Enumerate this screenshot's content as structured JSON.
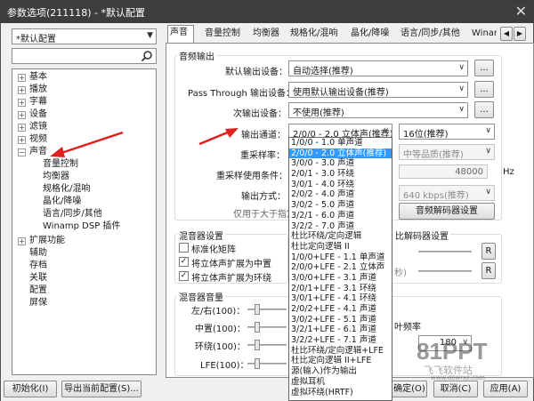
{
  "window": {
    "title": "参数选项(211118) - *默认配置",
    "close": "✕"
  },
  "left": {
    "profile": "*默认配置",
    "tree": [
      "基本",
      "播放",
      "字幕",
      "设备",
      "滤镜",
      "视频",
      "声音",
      "音量控制",
      "均衡器",
      "规格化/混响",
      "晶化/降噪",
      "语言/同步/其他",
      "Winamp DSP 插件",
      "扩展功能",
      "辅助",
      "存档",
      "关联",
      "配置",
      "屏保"
    ]
  },
  "tabs": [
    "声音",
    "音量控制",
    "均衡器",
    "规格化/混响",
    "晶化/降噪",
    "语言/同步/其他",
    "Winam"
  ],
  "audio_output": {
    "group": "音频输出",
    "default_device_label": "默认输出设备：",
    "default_device_value": "自动选择(推荐)",
    "passthrough_label": "Pass Through 输出设备：",
    "passthrough_value": "使用默认输出设备(推荐)",
    "secondary_label": "次输出设备：",
    "secondary_value": "不使用(推荐)",
    "channel_label": "输出通道：",
    "channel_value": "2/0/0 - 2.0 立体声(推荐)",
    "bitdepth_value": "16位(推荐)",
    "resample_label": "重采样率：",
    "resample_quality": "中等品质(推荐)",
    "resample_cond_label": "重采样使用条件：",
    "hz_value": "48000",
    "hz_unit": "Hz",
    "output_mode_label": "输出方式：",
    "bitrate_value": "640 kbps(推荐)",
    "only_when_label": "仅用于大于指定",
    "decoder_button": "音频解码器设置",
    "more": "..."
  },
  "mixer": {
    "group": "混音器设置",
    "opt1": "标准化矩阵",
    "opt2": "将立体声扩展为中置",
    "opt3": "将立体声扩展为环绕",
    "decoder_group": "比解码器设置",
    "ms_suffix": "秒)",
    "r_button": "R",
    "check": "✓"
  },
  "volume": {
    "group": "混音器音量",
    "rows": [
      "左/右(100)：",
      "中置(100)：",
      "环绕(100)：",
      "LFE(100)："
    ],
    "freq_label": "叶频率",
    "freq_value": "180"
  },
  "dropdown": {
    "items": [
      "1/0/0 - 1.0 单声道",
      "2/0/0 - 2.0 立体声(推荐)",
      "3/0/0 - 3.0 声道",
      "2/0/1 - 3.0 环绕",
      "3/0/1 - 4.0 环绕",
      "2/0/2 - 4.0 声道",
      "3/0/2 - 5.0 声道",
      "3/2/1 - 6.0 声道",
      "3/2/2 - 7.0 声道",
      "杜比环绕/定向逻辑",
      "杜比定向逻辑 II",
      "1/0/0+LFE - 1.1 单声道",
      "2/0/0+LFE - 2.1 立体声",
      "3/0/0+LFE - 3.1 声道",
      "2/0/1+LFE - 3.1 环绕",
      "3/0/1+LFE - 4.1 环绕",
      "2/0/2+LFE - 4.1 声道",
      "3/0/2+LFE - 5.1 声道",
      "3/2/1+LFE - 6.1 声道",
      "3/2/2+LFE - 7.1 声道",
      "杜比环绕/定向逻辑+LFE",
      "杜比定向逻辑 II+LFE",
      "源(输入)作为输出",
      "虚拟耳机",
      "虚拟环绕(HRTF)"
    ],
    "selected_index": 1
  },
  "footer": {
    "init": "初始化(I)",
    "export": "导出当前配置(S)...",
    "ok": "确定(O)",
    "cancel": "取消(C)",
    "apply": "应用(A)"
  },
  "watermark": {
    "brand": "81PPT",
    "cn": "飞飞软件站",
    "url": "www.dowrxz.com"
  },
  "colors": {
    "titlebar": "#3d3d3d",
    "selection": "#3399ff",
    "arrow": "#e02020"
  }
}
